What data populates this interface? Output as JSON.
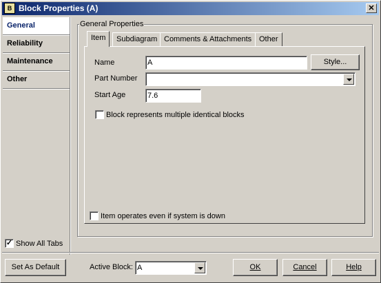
{
  "window": {
    "title": "Block Properties (A)",
    "app_icon_text": "B",
    "close_label": "✕"
  },
  "nav": {
    "items": [
      {
        "label": "General",
        "selected": true
      },
      {
        "label": "Reliability",
        "selected": false
      },
      {
        "label": "Maintenance",
        "selected": false
      },
      {
        "label": "Other",
        "selected": false
      }
    ],
    "show_all_tabs": {
      "label": "Show All Tabs",
      "checked": true
    }
  },
  "group": {
    "title": "General Properties",
    "tabs": [
      "Item",
      "Subdiagram",
      "Comments & Attachments",
      "Other"
    ],
    "active_tab": "Item"
  },
  "item": {
    "name_label": "Name",
    "name_value": "A",
    "style_button": "Style...",
    "part_number_label": "Part Number",
    "part_number_value": "",
    "start_age_label": "Start Age",
    "start_age_value": "7.6",
    "multi_blocks_label": "Block represents multiple identical blocks",
    "multi_blocks_checked": false,
    "operates_label": "Item operates even if system is down",
    "operates_checked": false
  },
  "footer": {
    "set_default": "Set As Default",
    "active_block_label": "Active Block:",
    "active_block_value": "A",
    "ok": "OK",
    "cancel": "Cancel",
    "help": "Help"
  },
  "colors": {
    "title_gradient_start": "#0a246a",
    "title_gradient_end": "#a6caf0",
    "face": "#d4d0c8",
    "selected_nav_text": "#0a246a"
  }
}
